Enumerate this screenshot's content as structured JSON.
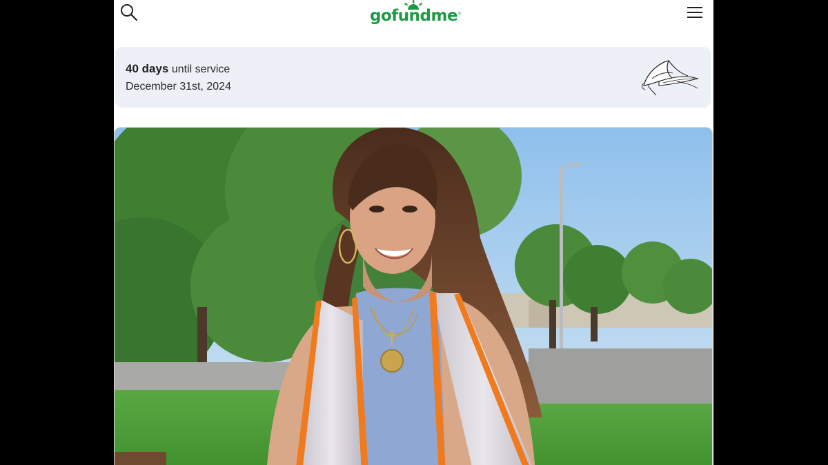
{
  "header": {
    "logo_text": "gofundme",
    "logo_trademark": "®",
    "search_icon": "search-icon",
    "menu_icon": "hamburger-menu-icon"
  },
  "service_card": {
    "days_count": "40 days",
    "days_suffix": " until service",
    "date": "December 31st, 2024",
    "decoration_icon": "calla-lily-icon"
  },
  "campaign_photo": {
    "subject": "campaign-cover-photo"
  },
  "colors": {
    "brand_green": "#1d9a46",
    "card_bg": "#eef0f8",
    "backdrop": "#000000"
  }
}
